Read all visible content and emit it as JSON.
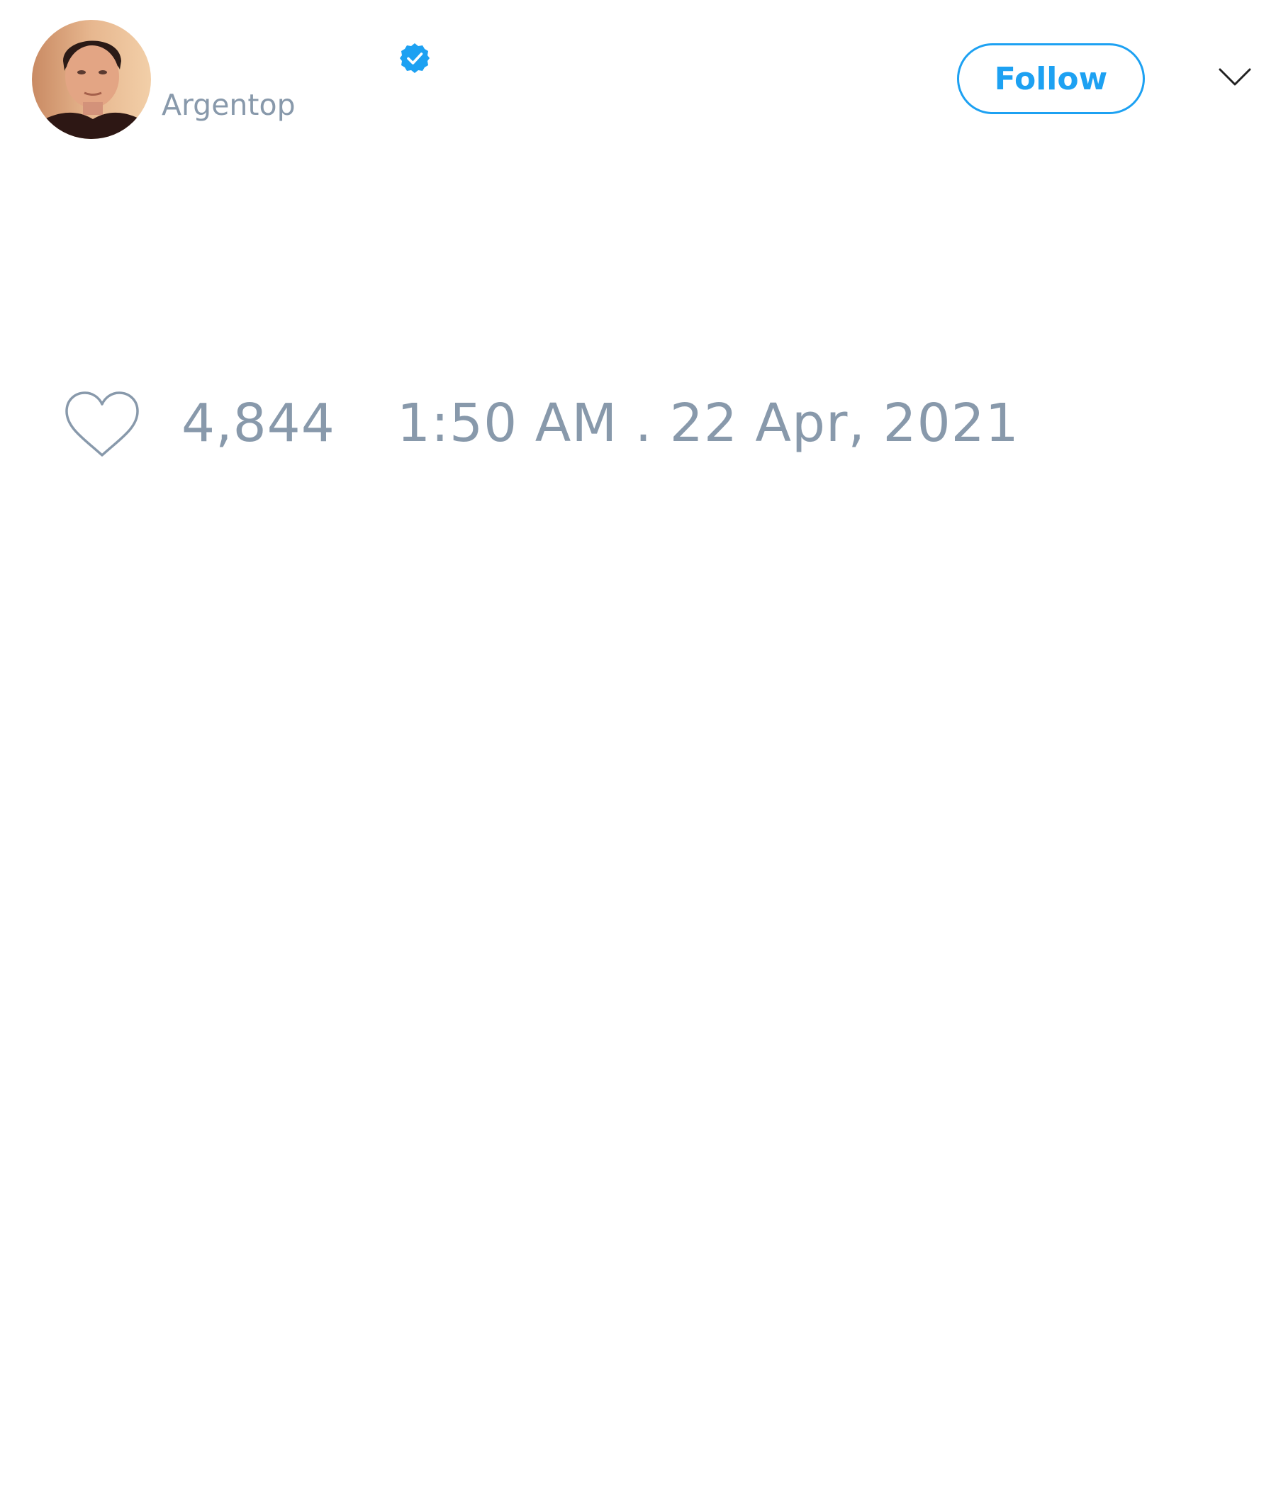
{
  "tweet": {
    "author": {
      "handle": "Argentop",
      "avatar": "avatar-photo",
      "verified": true,
      "verified_icon": "verified-badge-icon"
    },
    "follow_label": "Follow",
    "more_icon": "chevron-down-icon",
    "likes": {
      "icon": "heart-icon",
      "count": "4,844"
    },
    "timestamp": "1:50 AM . 22 Apr, 2021"
  },
  "colors": {
    "accent": "#1da1f2",
    "muted_text": "#8899ab",
    "background": "#ffffff"
  }
}
